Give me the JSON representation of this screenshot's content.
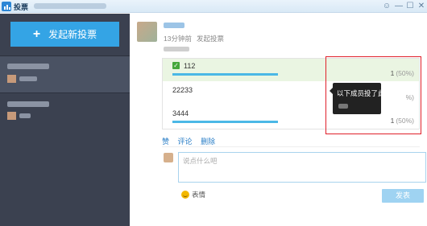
{
  "window": {
    "title": "投票",
    "buttons": [
      "☺",
      "—",
      "☐",
      "✕"
    ]
  },
  "sidebar": {
    "new_vote_label": "发起新投票",
    "new_vote_icon": "+"
  },
  "post": {
    "time": "13分钟前",
    "action": "发起投票"
  },
  "options": [
    {
      "label": "112",
      "count": "1",
      "pct": "(50%)",
      "selected": true,
      "fill": 0.5
    },
    {
      "label": "22233",
      "count": "",
      "pct": "%)",
      "selected": false,
      "fill": 0.0
    },
    {
      "label": "3444",
      "count": "1",
      "pct": "(50%)",
      "selected": false,
      "fill": 0.5
    }
  ],
  "tooltip": {
    "text": "以下成员投了此项"
  },
  "actions": {
    "like": "赞",
    "comment": "评论",
    "delete": "删除"
  },
  "comment_box": {
    "placeholder": "说点什么吧",
    "value": ""
  },
  "emoji_label": "表情",
  "send_label": "发表",
  "colors": {
    "accent": "#34a4e5",
    "bar": "#4bb8e6",
    "selected_bg": "#eaf5e2",
    "highlight_frame": "#e0202a",
    "sidebar": "#3b4150"
  }
}
